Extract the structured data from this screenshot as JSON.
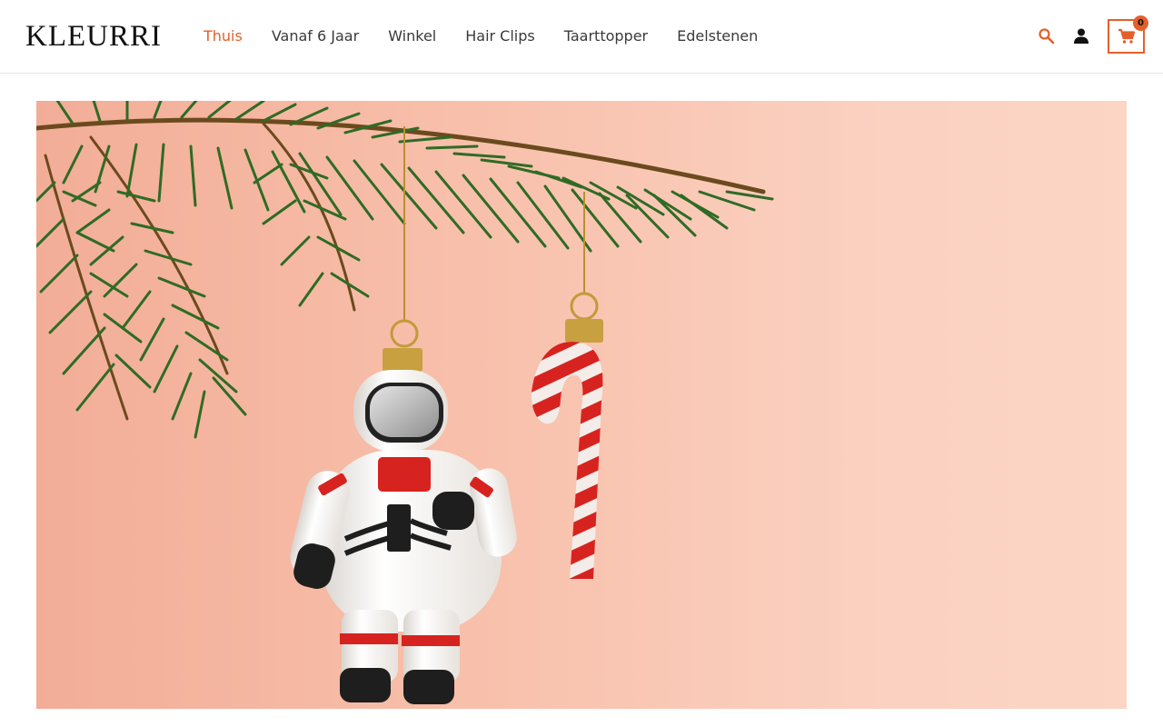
{
  "brand": {
    "logo_text": "KLEURRI"
  },
  "nav": {
    "items": [
      {
        "label": "Thuis",
        "active": true
      },
      {
        "label": "Vanaf 6 Jaar",
        "active": false
      },
      {
        "label": "Winkel",
        "active": false
      },
      {
        "label": "Hair Clips",
        "active": false
      },
      {
        "label": "Taarttopper",
        "active": false
      },
      {
        "label": "Edelstenen",
        "active": false
      }
    ]
  },
  "header_actions": {
    "search_icon": "search-icon",
    "account_icon": "user-icon",
    "cart_icon": "cart-icon",
    "cart_count": "0"
  },
  "colors": {
    "accent": "#e4602b",
    "hero_bg": "#f8c4b0"
  }
}
